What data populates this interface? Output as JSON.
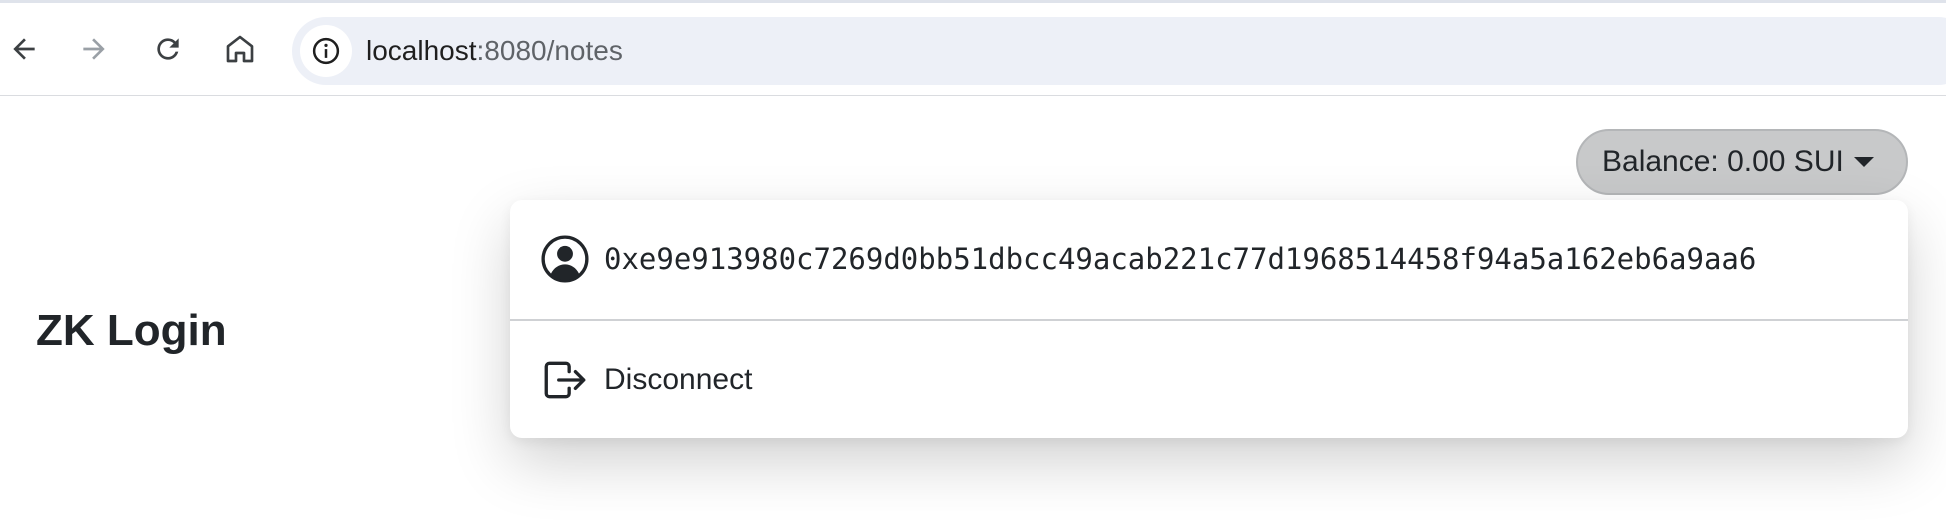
{
  "browser": {
    "url_host": "localhost",
    "url_rest": ":8080/notes",
    "icons": {
      "back": "arrow-left-icon",
      "forward": "arrow-right-icon",
      "reload": "reload-icon",
      "home": "home-icon",
      "site_info": "info-circle-icon"
    }
  },
  "page": {
    "title": "ZK Login"
  },
  "wallet": {
    "balance_label": "Balance: 0.00 SUI",
    "menu": {
      "address": "0xe9e913980c7269d0bb51dbcc49acab221c77d1968514458f94a5a162eb6a9aa6",
      "disconnect_label": "Disconnect"
    }
  },
  "colors": {
    "omnibox_bg": "#edf0f7",
    "balance_button_bg": "#c8c9ca",
    "text": "#212529"
  }
}
